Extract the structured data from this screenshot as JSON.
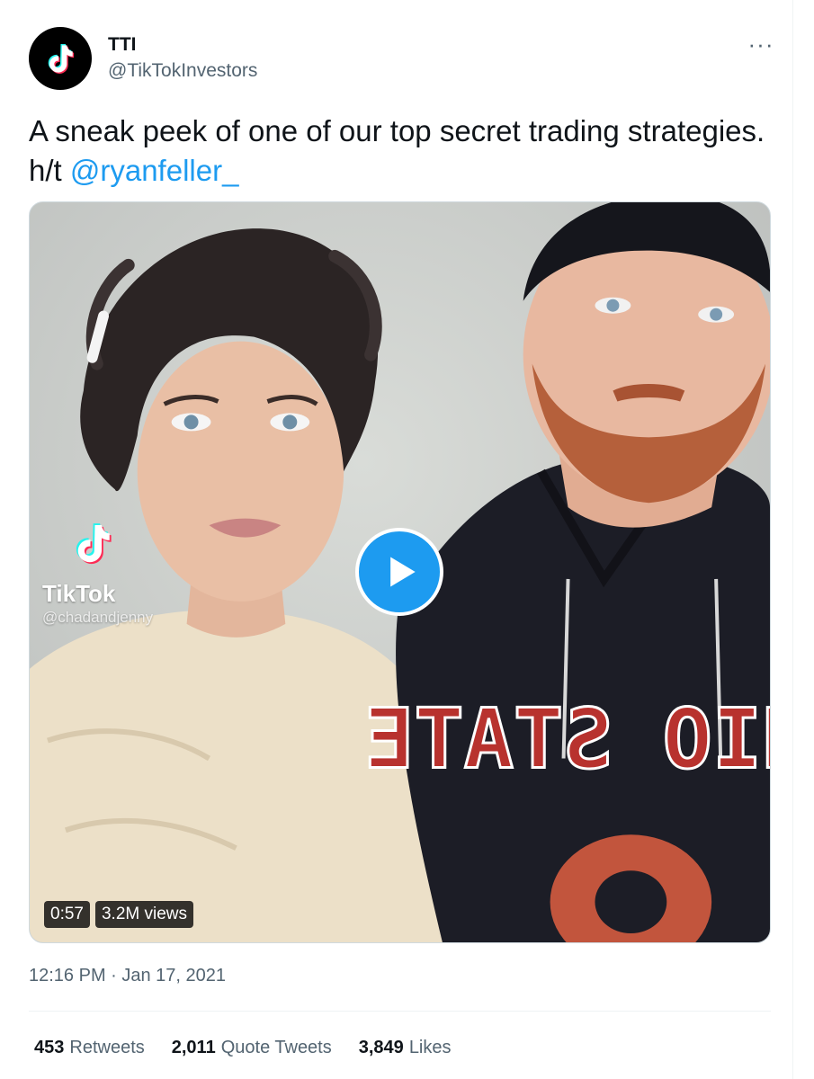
{
  "author": {
    "display_name": "TTI",
    "handle": "@TikTokInvestors",
    "avatar_icon": "tiktok-logo-icon"
  },
  "tweet": {
    "text": "A sneak peek of one of our top secret trading strategies. h/t ",
    "mention": "@ryanfeller_",
    "timestamp": "12:16 PM · Jan 17, 2021"
  },
  "media": {
    "watermark_brand": "TikTok",
    "watermark_user": "@chadandjenny",
    "duration": "0:57",
    "views": "3.2M views",
    "play_icon": "play-icon",
    "shirt_text": "OHIO STATE"
  },
  "stats": [
    {
      "count": "453",
      "label": "Retweets"
    },
    {
      "count": "2,011",
      "label": "Quote Tweets"
    },
    {
      "count": "3,849",
      "label": "Likes"
    }
  ],
  "colors": {
    "accent": "#1d9bf0",
    "text": "#0f1419",
    "muted": "#536471",
    "tiktok_cyan": "#25f4ee",
    "tiktok_red": "#fe2c55"
  }
}
